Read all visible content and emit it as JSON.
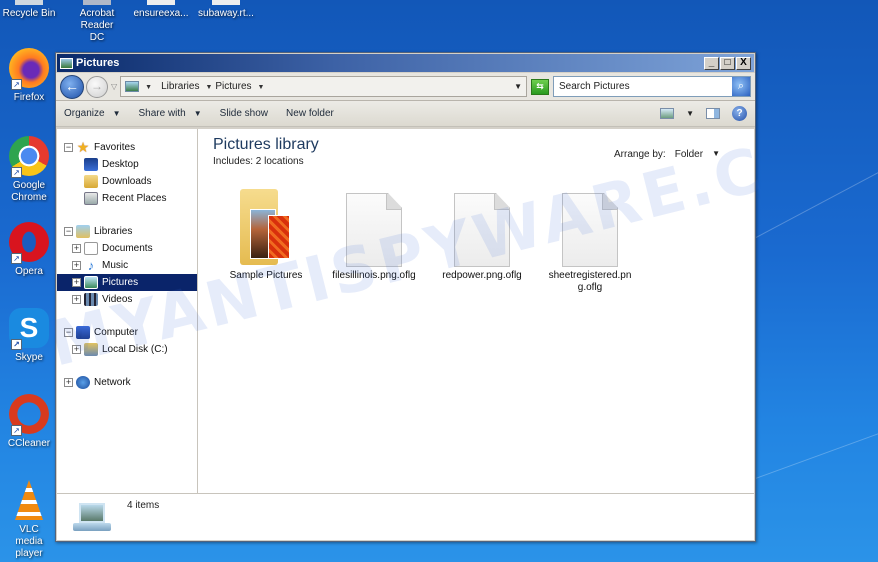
{
  "desktop": {
    "top_icons": [
      {
        "label": "Recycle Bin",
        "icon": "recycle-bin-icon"
      },
      {
        "label": "Acrobat Reader DC",
        "icon": "acrobat-icon"
      },
      {
        "label": "ensureexa...",
        "icon": "document-icon"
      },
      {
        "label": "subaway.rt...",
        "icon": "document-icon"
      }
    ],
    "left_icons": [
      {
        "label": "Firefox",
        "icon": "firefox-icon"
      },
      {
        "label": "Google Chrome",
        "icon": "chrome-icon"
      },
      {
        "label": "Opera",
        "icon": "opera-icon"
      },
      {
        "label": "Skype",
        "icon": "skype-icon"
      },
      {
        "label": "CCleaner",
        "icon": "ccleaner-icon"
      },
      {
        "label": "VLC media player",
        "icon": "vlc-icon"
      }
    ],
    "watermark": "MYANTISPYWARE.C"
  },
  "window": {
    "title": "Pictures",
    "controls": {
      "minimize": "_",
      "maximize": "□",
      "close": "X"
    },
    "address": {
      "crumbs": [
        "Libraries",
        "Pictures"
      ]
    },
    "search": {
      "placeholder": "Search Pictures"
    },
    "toolbar": {
      "organize": "Organize",
      "share_with": "Share with",
      "slide_show": "Slide show",
      "new_folder": "New folder"
    },
    "navpane": {
      "favorites": {
        "label": "Favorites",
        "items": [
          "Desktop",
          "Downloads",
          "Recent Places"
        ]
      },
      "libraries": {
        "label": "Libraries",
        "items": [
          "Documents",
          "Music",
          "Pictures",
          "Videos"
        ],
        "selected": "Pictures"
      },
      "computer": {
        "label": "Computer",
        "items": [
          "Local Disk (C:)"
        ]
      },
      "network": {
        "label": "Network"
      }
    },
    "content": {
      "title": "Pictures library",
      "includes": "Includes:  2 locations",
      "arrange_label": "Arrange by:",
      "arrange_value": "Folder",
      "files": [
        {
          "name": "Sample Pictures",
          "type": "folder"
        },
        {
          "name": "filesillinois.png.oflg",
          "type": "file"
        },
        {
          "name": "redpower.png.oflg",
          "type": "file"
        },
        {
          "name": "sheetregistered.png.oflg",
          "type": "file"
        }
      ]
    },
    "status": {
      "count": "4 items"
    }
  }
}
